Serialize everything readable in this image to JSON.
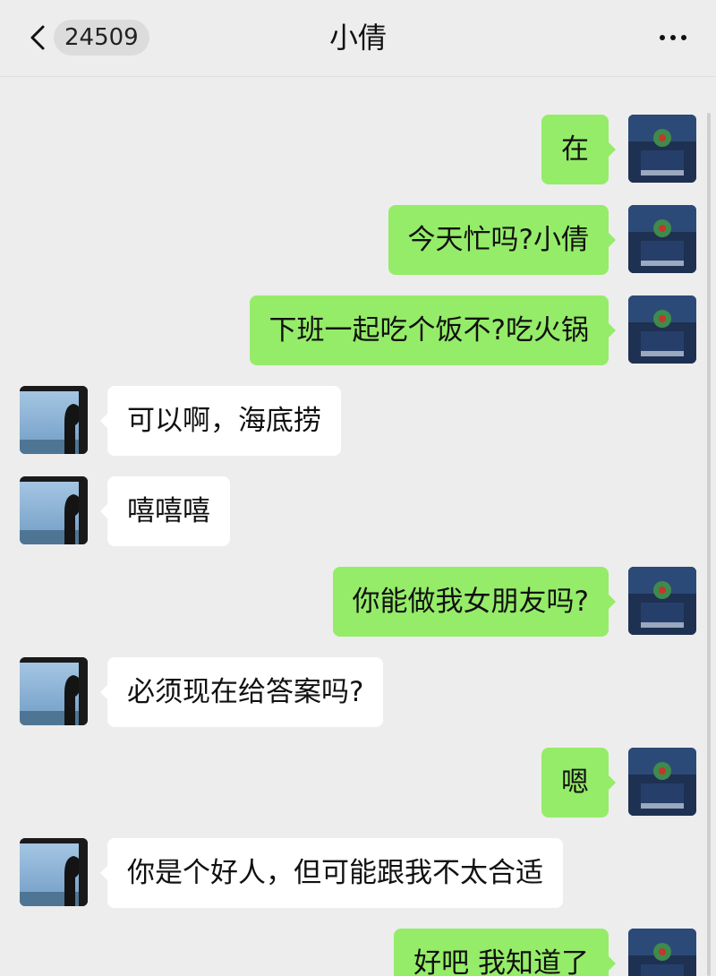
{
  "header": {
    "unread_count": "24509",
    "contact_name": "小倩",
    "back_icon": "chevron-left-icon",
    "more_icon": "more-dots-icon"
  },
  "messages": [
    {
      "side": "right",
      "text": "在"
    },
    {
      "side": "right",
      "text": "今天忙吗?小倩"
    },
    {
      "side": "right",
      "text": "下班一起吃个饭不?吃火锅"
    },
    {
      "side": "left",
      "text": "可以啊，海底捞"
    },
    {
      "side": "left",
      "text": "嘻嘻嘻"
    },
    {
      "side": "right",
      "text": "你能做我女朋友吗?"
    },
    {
      "side": "left",
      "text": "必须现在给答案吗?"
    },
    {
      "side": "right",
      "text": "嗯"
    },
    {
      "side": "left",
      "text": "你是个好人，但可能跟我不太合适"
    },
    {
      "side": "right",
      "text": "好吧 我知道了"
    }
  ],
  "colors": {
    "background": "#ededed",
    "self_bubble": "#95ec69",
    "other_bubble": "#ffffff"
  }
}
